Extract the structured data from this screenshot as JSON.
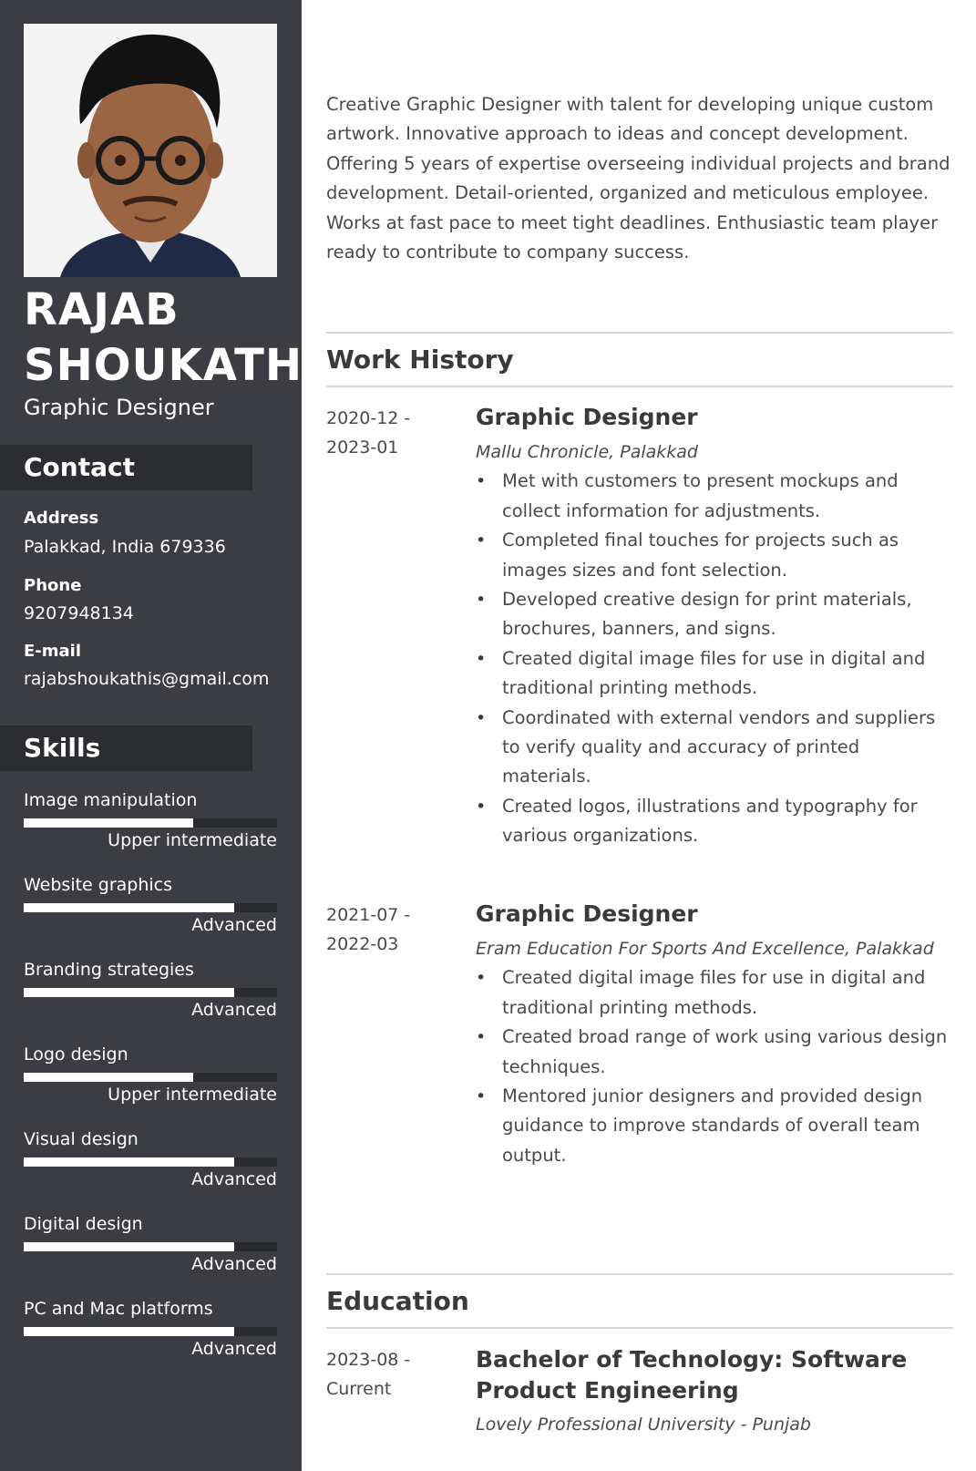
{
  "profile": {
    "name_line1": "RAJAB",
    "name_line2": "SHOUKATH",
    "role": "Graphic Designer"
  },
  "contact": {
    "heading": "Contact",
    "address_label": "Address",
    "address": "Palakkad, India 679336",
    "phone_label": "Phone",
    "phone": "9207948134",
    "email_label": "E-mail",
    "email": "rajabshoukathis@gmail.com"
  },
  "skills": {
    "heading": "Skills",
    "items": [
      {
        "name": "Image manipulation",
        "level": "Upper intermediate",
        "fill": 0.67
      },
      {
        "name": "Website graphics",
        "level": "Advanced",
        "fill": 0.83
      },
      {
        "name": "Branding strategies",
        "level": "Advanced",
        "fill": 0.83
      },
      {
        "name": "Logo design",
        "level": "Upper intermediate",
        "fill": 0.67
      },
      {
        "name": "Visual design",
        "level": "Advanced",
        "fill": 0.83
      },
      {
        "name": "Digital design",
        "level": "Advanced",
        "fill": 0.83
      },
      {
        "name": "PC and Mac platforms",
        "level": "Advanced",
        "fill": 0.83
      }
    ]
  },
  "summary": "Creative Graphic Designer with talent for developing unique custom artwork. Innovative approach to ideas and concept development. Offering 5 years of expertise overseeing individual projects and brand development. Detail-oriented, organized and meticulous employee. Works at fast pace to meet tight deadlines. Enthusiastic team player ready to contribute to company success.",
  "work": {
    "heading": "Work History",
    "jobs": [
      {
        "start": "2020-12 -",
        "end": "2023-01",
        "title": "Graphic Designer",
        "company": "Mallu Chronicle, Palakkad",
        "bullets": [
          "Met with customers to present mockups and collect information for adjustments.",
          "Completed final touches for projects such as images sizes and font selection.",
          "Developed creative design for print materials, brochures, banners, and signs.",
          "Created digital image files for use in digital and traditional printing methods.",
          "Coordinated with external vendors and suppliers to verify quality and accuracy of printed materials.",
          "Created logos, illustrations and typography for various organizations."
        ]
      },
      {
        "start": "2021-07 -",
        "end": "2022-03",
        "title": "Graphic Designer",
        "company": "Eram Education For Sports And Excellence, Palakkad",
        "bullets": [
          "Created digital image files for use in digital and traditional printing methods.",
          "Created broad range of work using various design techniques.",
          "Mentored junior designers and provided design guidance to improve standards of overall team output."
        ]
      }
    ]
  },
  "education": {
    "heading": "Education",
    "start": "2023-08 -",
    "end": "Current",
    "degree": "Bachelor of Technology: Software Product Engineering",
    "school": "Lovely Professional University - Punjab"
  }
}
